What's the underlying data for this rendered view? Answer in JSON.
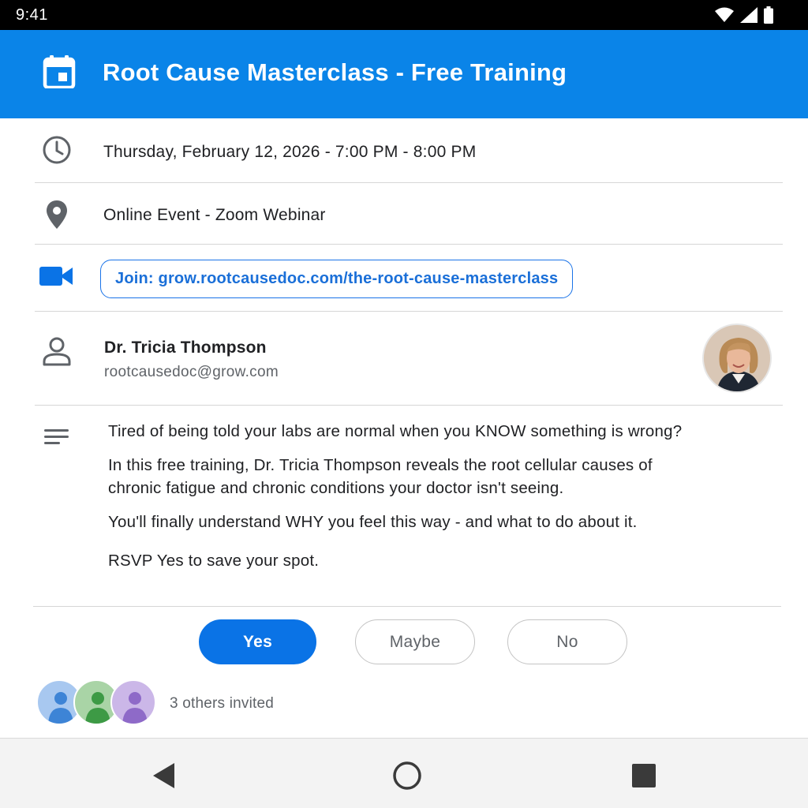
{
  "status_bar": {
    "time": "9:41",
    "icons": [
      "wifi-icon",
      "cell-signal-icon",
      "battery-icon"
    ]
  },
  "app_bar": {
    "icon": "calendar-icon",
    "title": "Root Cause Masterclass - Free Training",
    "color": "#0a84e8"
  },
  "event": {
    "datetime": "Thursday, February 12, 2026 - 7:00 PM - 8:00 PM",
    "location": "Online Event - Zoom Webinar",
    "join_label": "Join: grow.rootcausedoc.com/the-root-cause-masterclass",
    "organizer": {
      "name": "Dr. Tricia Thompson",
      "email": "rootcausedoc@grow.com"
    },
    "description": [
      "Tired of being told your labs are normal when you KNOW something is wrong?",
      "In this free training, Dr. Tricia Thompson reveals the root cellular causes of chronic fatigue and chronic conditions your doctor isn't seeing.",
      "You'll finally understand WHY you feel this way - and what to do about it.",
      "RSVP Yes to save your spot."
    ]
  },
  "rsvp": {
    "yes": "Yes",
    "maybe": "Maybe",
    "no": "No",
    "selected": "yes",
    "accent": "#0a73e6"
  },
  "invitees": {
    "summary": "3 others invited",
    "avatar_colors": [
      "#a8c8f0",
      "#a9d4a6",
      "#cbb7e8"
    ]
  },
  "nav_bar": {
    "icons": [
      "back-icon",
      "home-icon",
      "recents-icon"
    ]
  }
}
